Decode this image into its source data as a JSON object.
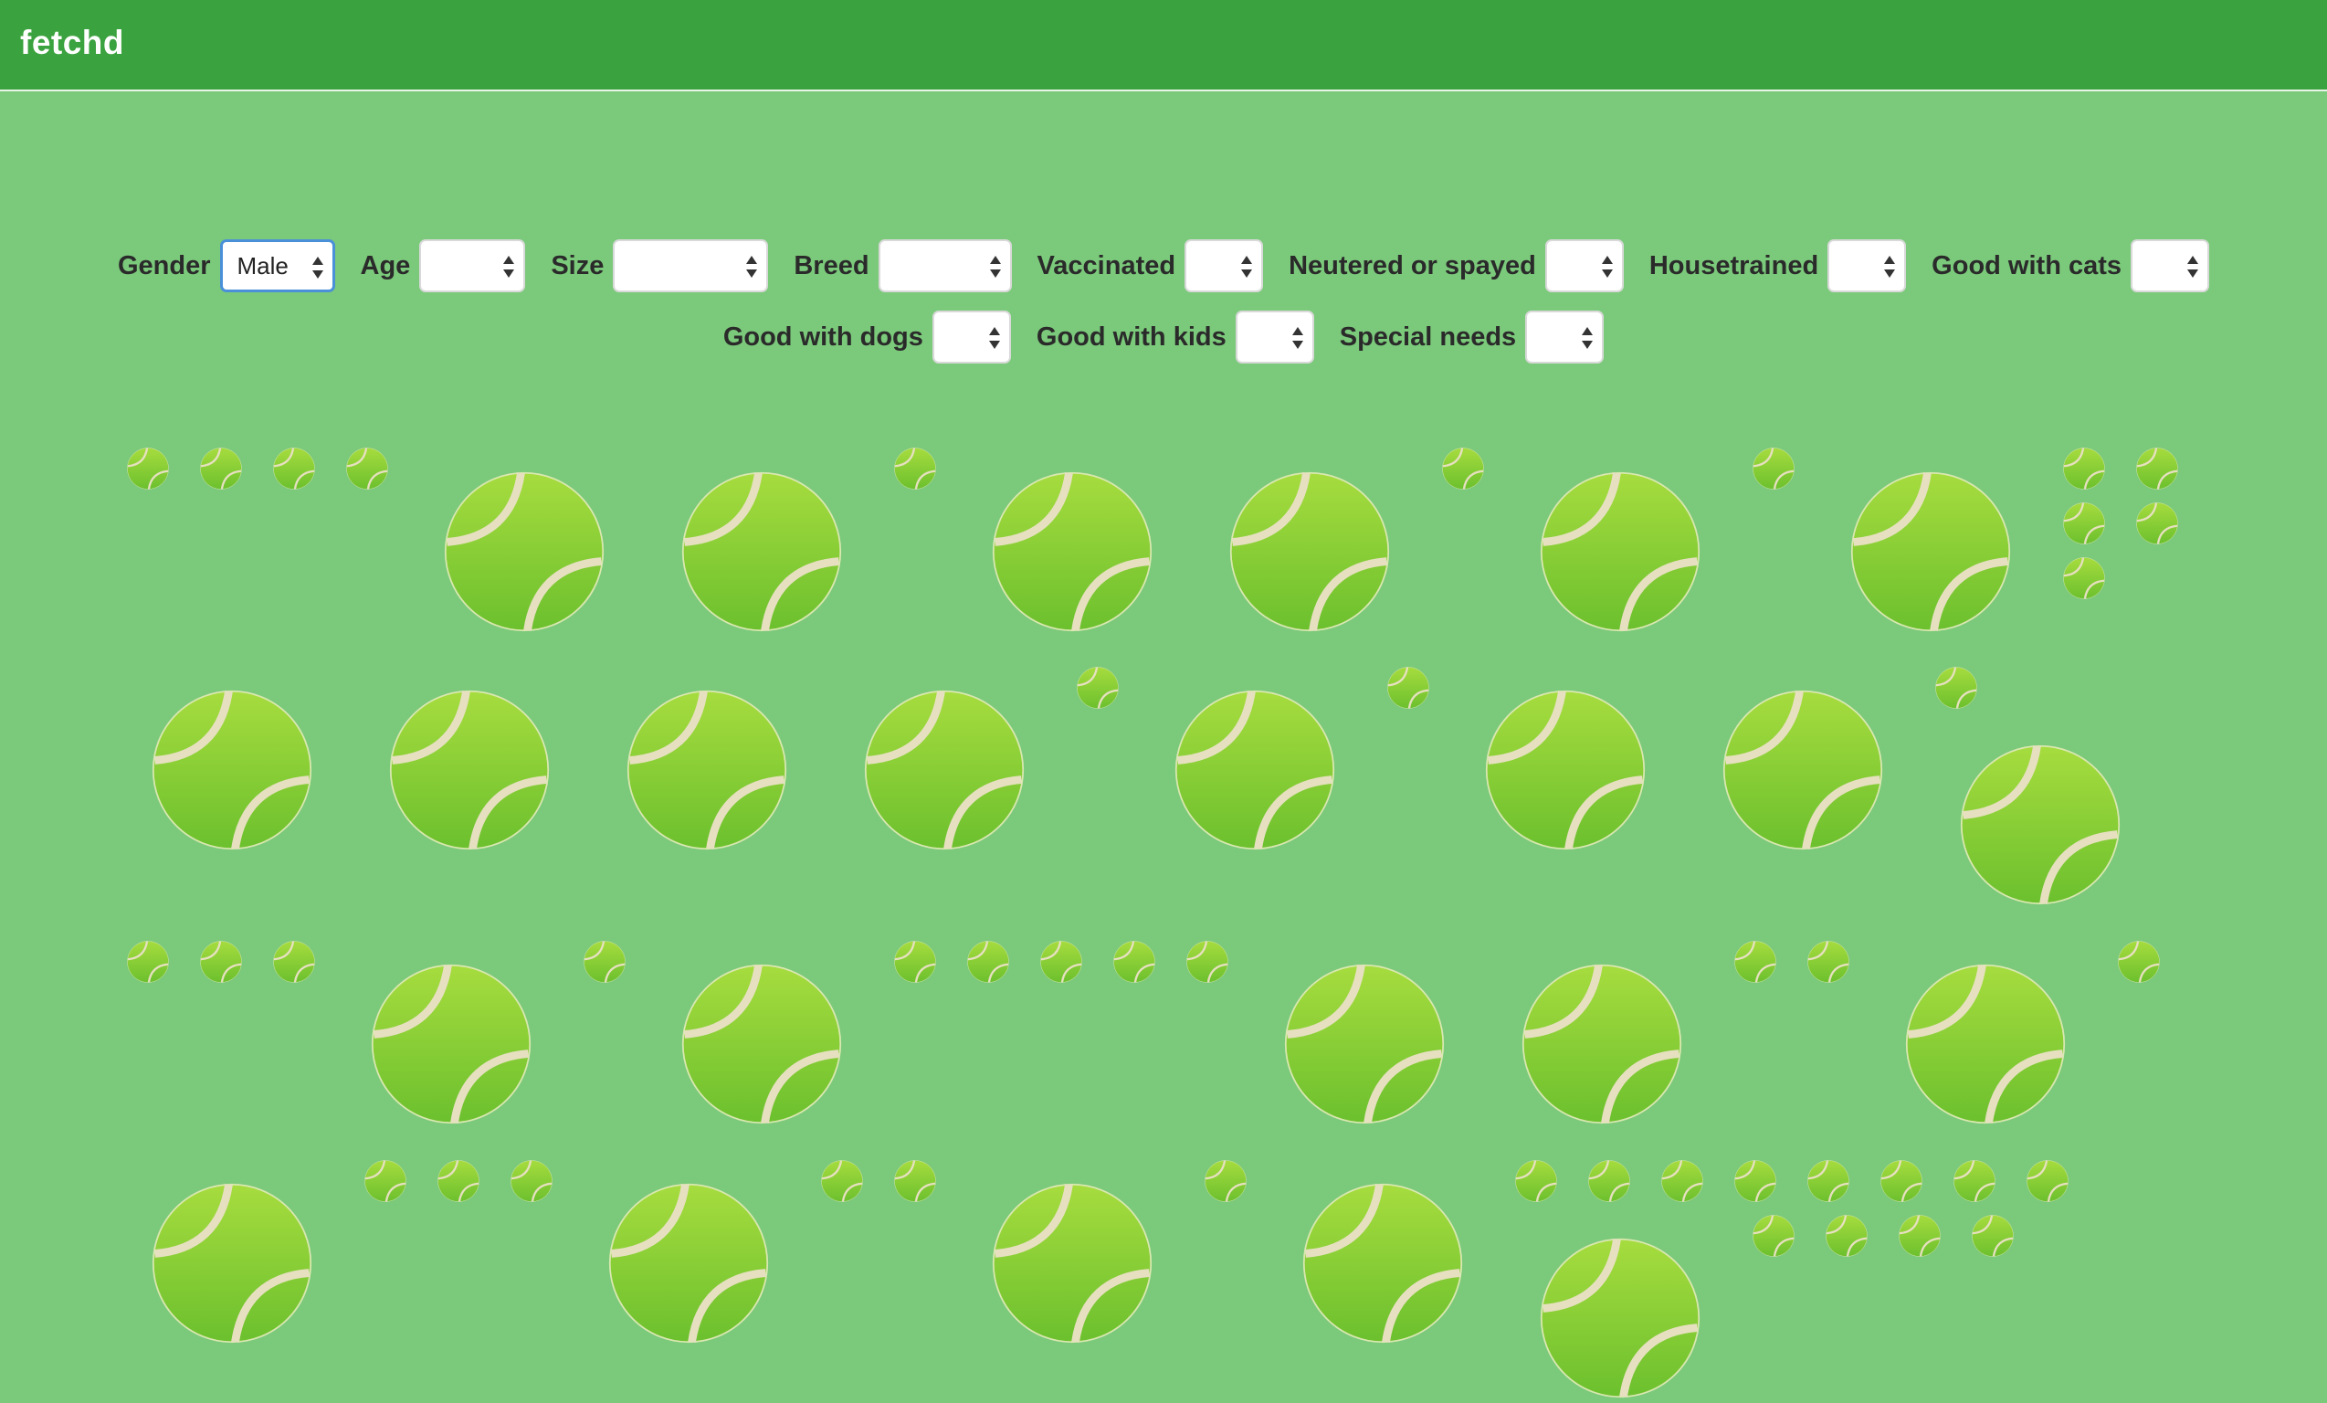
{
  "navbar": {
    "brand": "fetchd"
  },
  "filters": {
    "row1": [
      {
        "id": "gender",
        "label": "Gender",
        "value": "Male",
        "width": 126,
        "active": true
      },
      {
        "id": "age",
        "label": "Age",
        "value": "",
        "width": 116
      },
      {
        "id": "size",
        "label": "Size",
        "value": "",
        "width": 170
      },
      {
        "id": "breed",
        "label": "Breed",
        "value": "",
        "width": 146
      },
      {
        "id": "vaccinated",
        "label": "Vaccinated",
        "value": "",
        "width": 86
      },
      {
        "id": "neutered",
        "label": "Neutered or spayed",
        "value": "",
        "width": 86
      },
      {
        "id": "housetrained",
        "label": "Housetrained",
        "value": "",
        "width": 86
      },
      {
        "id": "good-with-cats",
        "label": "Good with cats",
        "value": "",
        "width": 86
      }
    ],
    "row2": [
      {
        "id": "good-with-dogs",
        "label": "Good with dogs",
        "value": "",
        "width": 86
      },
      {
        "id": "good-with-kids",
        "label": "Good with kids",
        "value": "",
        "width": 86
      },
      {
        "id": "special-needs",
        "label": "Special needs",
        "value": "",
        "width": 86
      }
    ]
  },
  "icons": {
    "listing_marker": "tennis-ball-icon"
  },
  "colors": {
    "navbar": "#3aa23e",
    "background": "#7bc97b",
    "ball": "#8fd43a",
    "seam": "#e6e0c0"
  }
}
